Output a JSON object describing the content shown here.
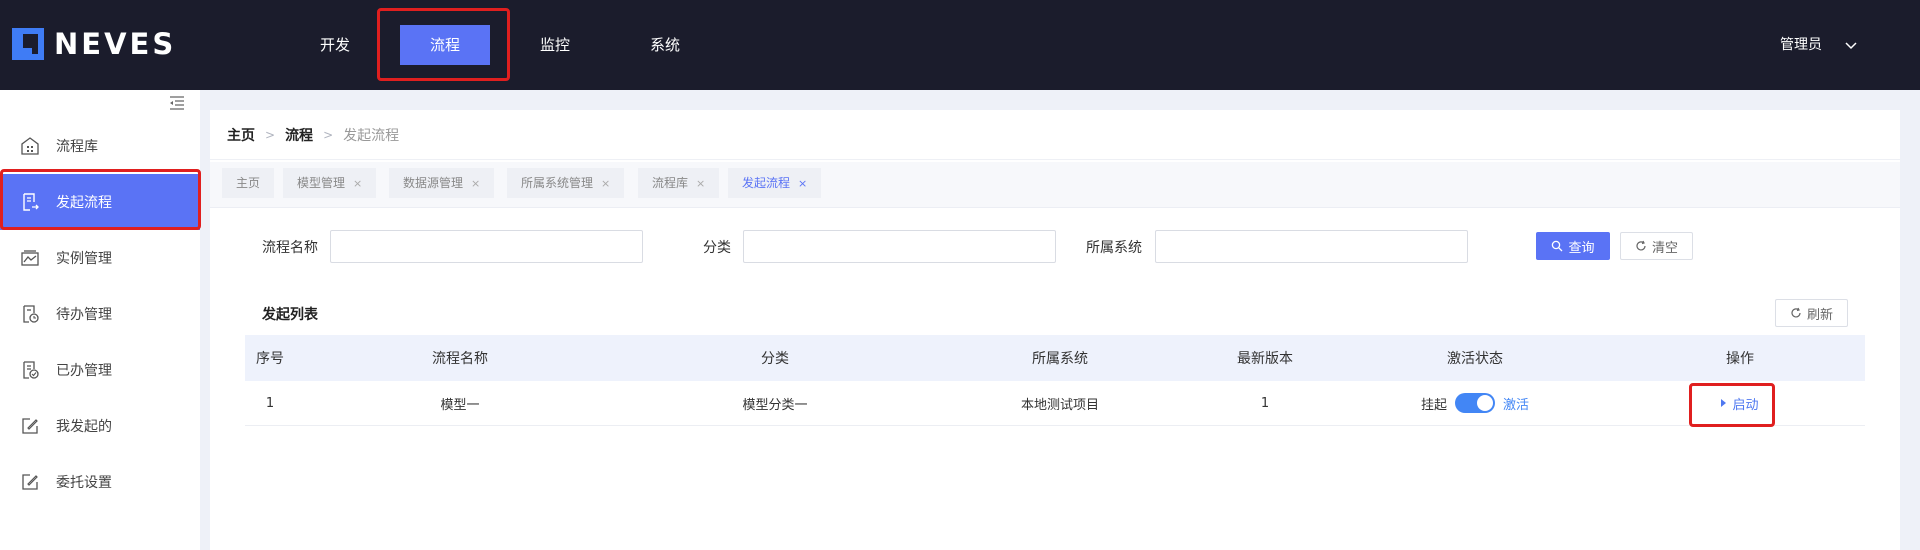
{
  "header": {
    "brand": "NEVES",
    "nav": [
      {
        "label": "开发"
      },
      {
        "label": "流程"
      },
      {
        "label": "监控"
      },
      {
        "label": "系统"
      }
    ],
    "user": "管理员"
  },
  "sidebar": {
    "items": [
      {
        "label": "流程库",
        "icon": "building-icon"
      },
      {
        "label": "发起流程",
        "icon": "document-export-icon"
      },
      {
        "label": "实例管理",
        "icon": "inbox-chart-icon"
      },
      {
        "label": "待办管理",
        "icon": "document-clock-icon"
      },
      {
        "label": "已办管理",
        "icon": "document-check-icon"
      },
      {
        "label": "我发起的",
        "icon": "edit-icon"
      },
      {
        "label": "委托设置",
        "icon": "edit-icon"
      }
    ]
  },
  "breadcrumb": {
    "home": "主页",
    "section": "流程",
    "current": "发起流程"
  },
  "tabs": [
    {
      "label": "主页",
      "closable": false
    },
    {
      "label": "模型管理",
      "closable": true
    },
    {
      "label": "数据源管理",
      "closable": true
    },
    {
      "label": "所属系统管理",
      "closable": true
    },
    {
      "label": "流程库",
      "closable": true
    },
    {
      "label": "发起流程",
      "closable": true
    }
  ],
  "tab_close": "×",
  "search": {
    "name_label": "流程名称",
    "category_label": "分类",
    "system_label": "所属系统",
    "query_button": "查询",
    "clear_button": "清空"
  },
  "list": {
    "title": "发起列表",
    "refresh_button": "刷新",
    "columns": [
      "序号",
      "流程名称",
      "分类",
      "所属系统",
      "最新版本",
      "激活状态",
      "操作"
    ],
    "rows": [
      {
        "index": "1",
        "name": "模型一",
        "category": "模型分类一",
        "system": "本地测试项目",
        "version": "1",
        "state_off": "挂起",
        "state_on": "激活",
        "action": "启动"
      }
    ]
  },
  "colors": {
    "primary": "#5a73f5",
    "header_bg": "#1b1c2c",
    "highlight": "#e01f1f",
    "switch": "#4286f5"
  }
}
